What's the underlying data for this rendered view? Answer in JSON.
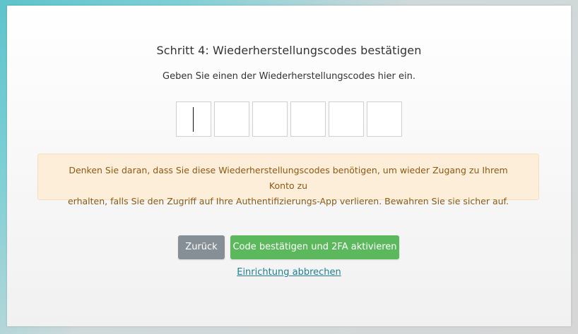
{
  "dialog": {
    "title": "Schritt 4: Wiederherstellungscodes bestätigen",
    "instruction": "Geben Sie einen der Wiederherstellungscodes hier ein.",
    "code_inputs": [
      "",
      "",
      "",
      "",
      "",
      ""
    ],
    "warning_line1": "Denken Sie daran, dass Sie diese Wiederherstellungscodes benötigen, um wieder Zugang zu Ihrem Konto zu",
    "warning_line2": "erhalten, falls Sie den Zugriff auf Ihre Authentifizierungs-App verlieren. Bewahren Sie sie sicher auf.",
    "back_label": "Zurück",
    "confirm_label": "Code bestätigen und 2FA aktivieren",
    "cancel_label": "Einrichtung abbrechen"
  },
  "colors": {
    "warning_bg": "#fdeed9",
    "warning_text": "#8a5a12",
    "back_button": "#868e96",
    "confirm_button": "#5cb85c",
    "link": "#1f7f8f"
  }
}
